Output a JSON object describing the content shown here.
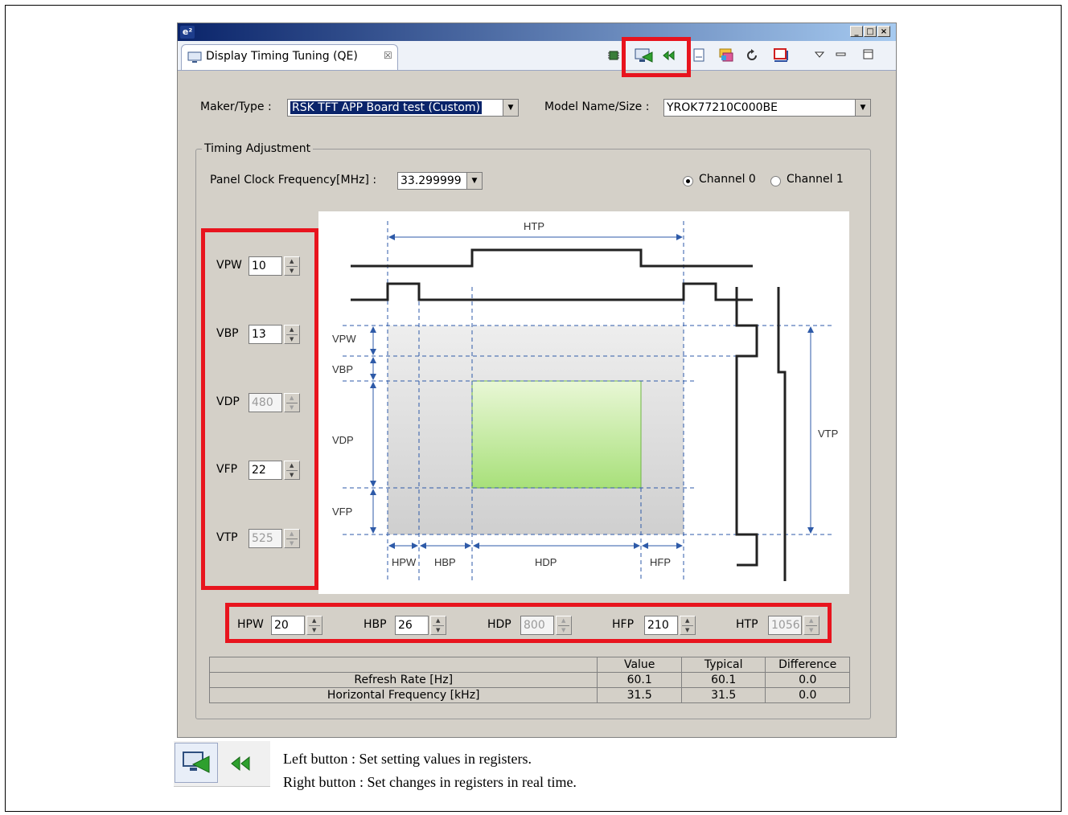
{
  "window": {
    "app_icon": "e²",
    "min_label": "_",
    "max_label": "□",
    "close_label": "×",
    "tab_title": "Display Timing Tuning (QE)",
    "tab_close": "☒"
  },
  "toolbar": {
    "icons": [
      "chip-icon",
      "set-registers-icon",
      "realtime-registers-icon",
      "doc-icon",
      "palette-icon",
      "refresh-icon",
      "monitor-icon",
      "view-menu-icon",
      "minimize-view-icon",
      "maximize-view-icon"
    ]
  },
  "form": {
    "maker_label": "Maker/Type :",
    "maker_value": "RSK TFT APP Board test (Custom)",
    "model_label": "Model Name/Size :",
    "model_value": "YROK77210C000BE"
  },
  "timing": {
    "group_label": "Timing Adjustment",
    "clock_label": "Panel Clock Frequency[MHz] :",
    "clock_value": "33.299999",
    "channel0": "Channel 0",
    "channel1": "Channel 1"
  },
  "vertical": [
    {
      "label": "VPW",
      "value": "10",
      "enabled": true
    },
    {
      "label": "VBP",
      "value": "13",
      "enabled": true
    },
    {
      "label": "VDP",
      "value": "480",
      "enabled": false
    },
    {
      "label": "VFP",
      "value": "22",
      "enabled": true
    },
    {
      "label": "VTP",
      "value": "525",
      "enabled": false
    }
  ],
  "horizontal": [
    {
      "label": "HPW",
      "value": "20",
      "enabled": true
    },
    {
      "label": "HBP",
      "value": "26",
      "enabled": true
    },
    {
      "label": "HDP",
      "value": "800",
      "enabled": false
    },
    {
      "label": "HFP",
      "value": "210",
      "enabled": true
    },
    {
      "label": "HTP",
      "value": "1056",
      "enabled": false
    }
  ],
  "diagram": {
    "htp": "HTP",
    "vpw": "VPW",
    "vbp": "VBP",
    "vdp": "VDP",
    "vfp": "VFP",
    "vtp": "VTP",
    "hpw": "HPW",
    "hbp": "HBP",
    "hdp": "HDP",
    "hfp": "HFP"
  },
  "results": {
    "headers": [
      "Value",
      "Typical",
      "Difference"
    ],
    "rows": [
      {
        "name": "Refresh Rate [Hz]",
        "value": "60.1",
        "typical": "60.1",
        "difference": "0.0"
      },
      {
        "name": "Horizontal Frequency [kHz]",
        "value": "31.5",
        "typical": "31.5",
        "difference": "0.0"
      }
    ]
  },
  "caption": {
    "line1": "Left button : Set setting values in registers.",
    "line2": "Right button : Set changes in registers in real time."
  }
}
